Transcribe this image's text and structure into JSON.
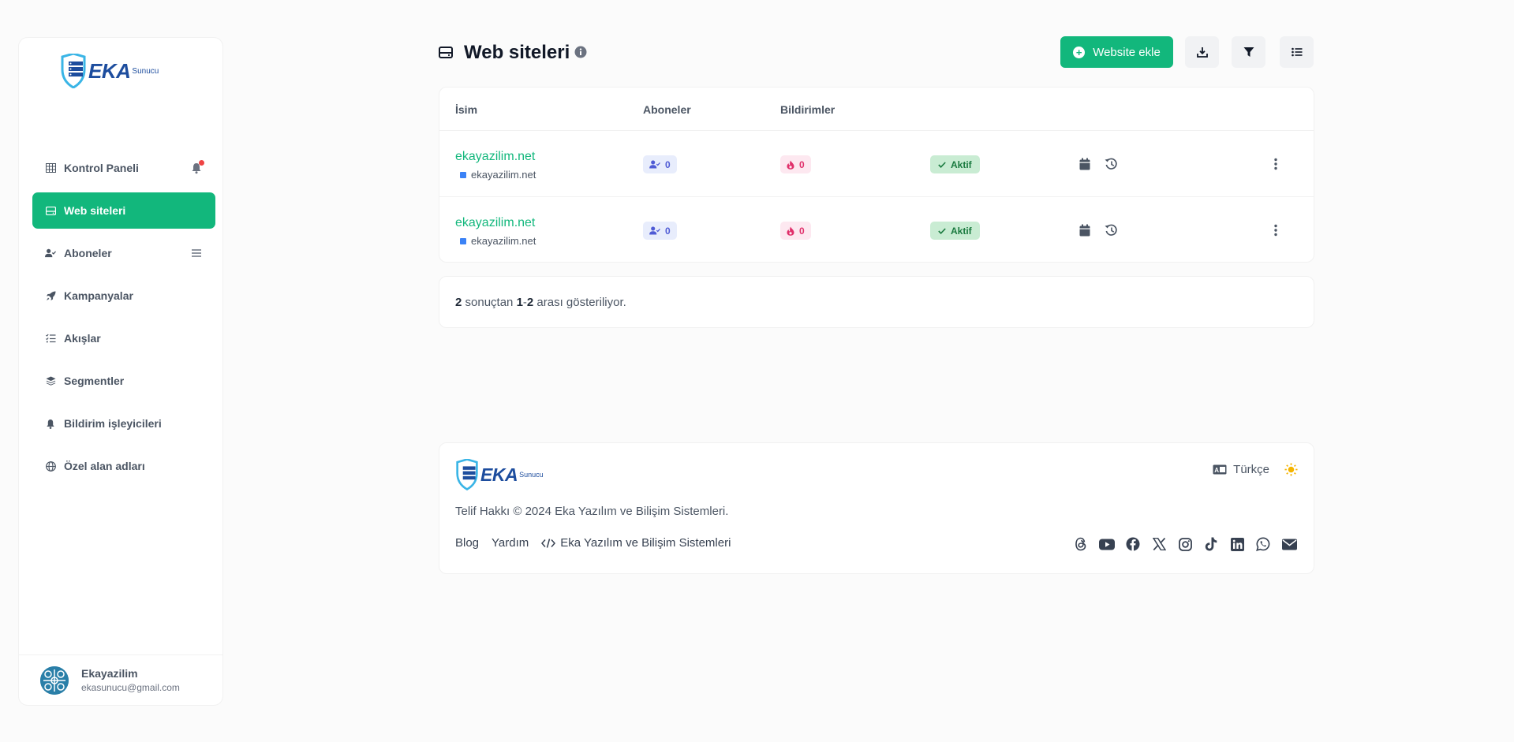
{
  "sidebar": {
    "brand": {
      "word": "EKA",
      "sub": "Sunucu"
    },
    "items": [
      {
        "label": "Kontrol Paneli"
      },
      {
        "label": "Web siteleri"
      },
      {
        "label": "Aboneler"
      },
      {
        "label": "Kampanyalar"
      },
      {
        "label": "Akışlar"
      },
      {
        "label": "Segmentler"
      },
      {
        "label": "Bildirim işleyicileri"
      },
      {
        "label": "Özel alan adları"
      }
    ],
    "active_index": 1,
    "user": {
      "name": "Ekayazilim",
      "email": "ekasunucu@gmail.com"
    }
  },
  "header": {
    "title": "Web siteleri",
    "add_button": "Website ekle"
  },
  "table": {
    "columns": [
      "İsim",
      "Aboneler",
      "Bildirimler"
    ],
    "rows": [
      {
        "name": "ekayazilim.net",
        "domain": "ekayazilim.net",
        "subscribers": "0",
        "notifications": "0",
        "status": "Aktif"
      },
      {
        "name": "ekayazilim.net",
        "domain": "ekayazilim.net",
        "subscribers": "0",
        "notifications": "0",
        "status": "Aktif"
      }
    ]
  },
  "pager": {
    "total": "2",
    "t1": " sonuçtan ",
    "range_start": "1",
    "dash": "-",
    "range_end": "2",
    "t2": " arası gösteriliyor."
  },
  "footer": {
    "copyright": "Telif Hakkı © 2024 Eka Yazılım ve Bilişim Sistemleri.",
    "links": [
      "Blog",
      "Yardım",
      "Eka Yazılım ve Bilişim Sistemleri"
    ],
    "language": "Türkçe"
  },
  "colors": {
    "accent": "#12b77c",
    "link": "#12b77c",
    "status_bg": "#c9ecd3"
  }
}
